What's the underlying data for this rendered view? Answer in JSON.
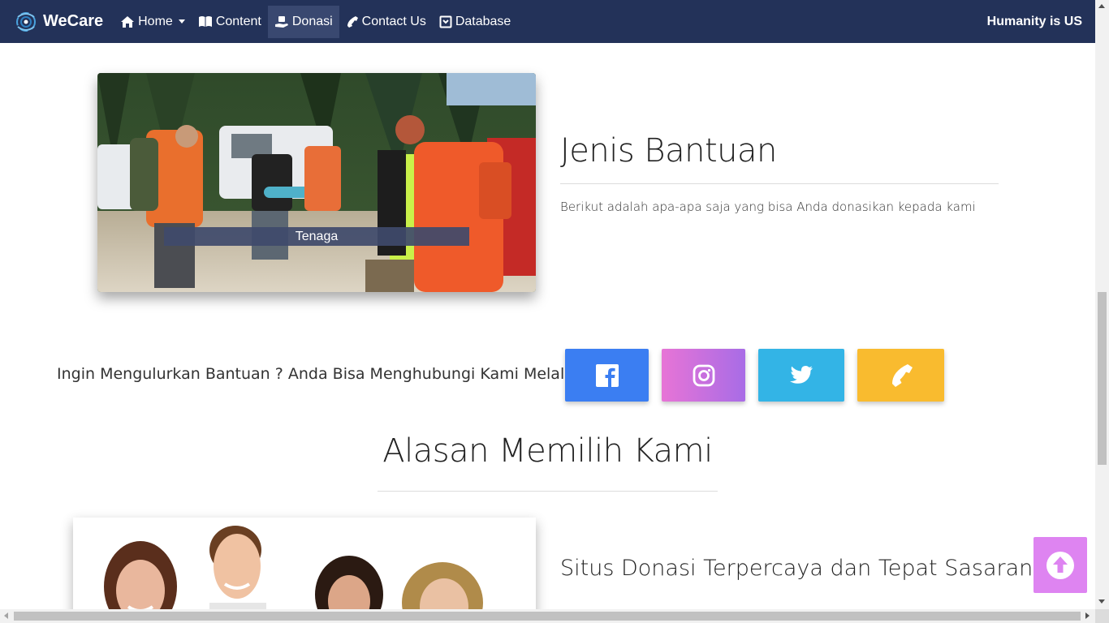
{
  "navbar": {
    "brand": "WeCare",
    "items": [
      {
        "label": "Home",
        "icon": "home-icon",
        "dropdown": true
      },
      {
        "label": "Content",
        "icon": "book-icon"
      },
      {
        "label": "Donasi",
        "icon": "donate-icon",
        "active": true
      },
      {
        "label": "Contact Us",
        "icon": "phone-icon"
      },
      {
        "label": "Database",
        "icon": "database-icon"
      }
    ],
    "tagline": "Humanity is US",
    "bg_color": "#233259"
  },
  "jenis": {
    "image_caption": "Tenaga",
    "title": "Jenis Bantuan",
    "description": "Berikut adalah apa-apa saja yang bisa Anda donasikan kepada kami"
  },
  "contact": {
    "text": "Ingin Mengulurkan Bantuan ? Anda Bisa Menghubungi Kami Melalui",
    "buttons": [
      {
        "name": "facebook",
        "icon": "facebook-icon",
        "color": "#3b7ef2"
      },
      {
        "name": "instagram",
        "icon": "instagram-icon",
        "color": "#c070e0"
      },
      {
        "name": "twitter",
        "icon": "twitter-icon",
        "color": "#33b4e6"
      },
      {
        "name": "phone",
        "icon": "phone-icon",
        "color": "#f9bb2f"
      }
    ]
  },
  "alasan": {
    "title": "Alasan Memilih Kami",
    "item_title": "Situs Donasi Terpercaya dan Tepat Sasaran"
  },
  "back_to_top": {
    "icon": "arrow-up-circle-icon",
    "color": "#de84f1"
  }
}
